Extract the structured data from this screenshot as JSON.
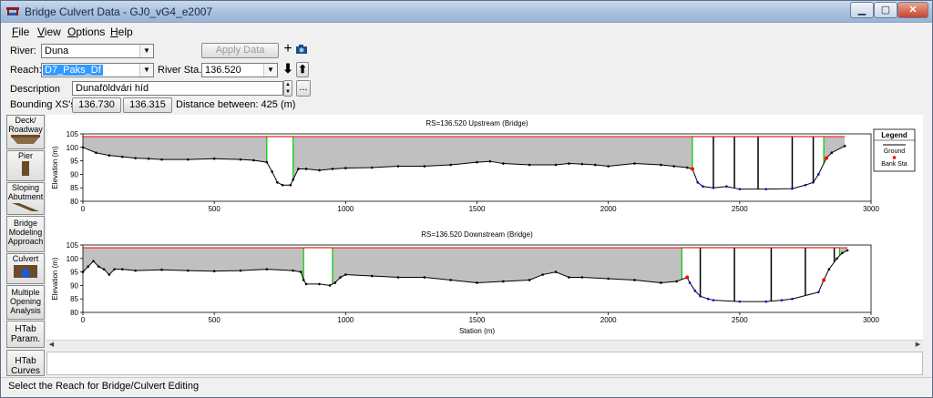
{
  "window": {
    "title": "Bridge Culvert Data - GJ0_vG4_e2007"
  },
  "menu": [
    "File",
    "View",
    "Options",
    "Help"
  ],
  "menu_underline": [
    "F",
    "V",
    "O",
    "H"
  ],
  "fields": {
    "river_label": "River:",
    "river_value": "Duna",
    "reach_label": "Reach:",
    "reach_value": "D7_Paks_Df",
    "river_sta_label": "River Sta.:",
    "river_sta_value": "136.520",
    "description_label": "Description",
    "description_value": "Dunaföldvári híd",
    "bounding_label": "Bounding XS's:",
    "bounding_up": "136.730",
    "bounding_down": "136.315",
    "distance_text": "Distance between: 425 (m)",
    "apply_label": "Apply Data",
    "more_label": "..."
  },
  "sidebar": [
    {
      "label": "Deck/ Roadway",
      "icon": "deck-icon"
    },
    {
      "label": "Pier",
      "icon": "pier-icon"
    },
    {
      "label": "Sloping Abutment",
      "icon": "abutment-icon"
    },
    {
      "label": "Bridge Modeling Approach",
      "icon": ""
    },
    {
      "label": "Culvert",
      "icon": "culvert-icon"
    },
    {
      "label": "Multiple Opening Analysis",
      "icon": ""
    },
    {
      "label": "HTab Param.",
      "icon": ""
    },
    {
      "label": "HTab Curves",
      "icon": ""
    }
  ],
  "legend": {
    "title": "Legend",
    "items": [
      "Ground",
      "Bank Sta"
    ]
  },
  "status": {
    "text": "Select the Reach for Bridge/Culvert Editing"
  },
  "colors": {
    "ground": "#000000",
    "fill": "#c0c0c0",
    "deck": "#ff0000",
    "opening": "#00cc00",
    "bank": "#ff0000",
    "ineffective": "#0000cc",
    "selected": "#3399ff"
  },
  "chart_data": [
    {
      "type": "line",
      "title": "RS=136.520 Upstream  (Bridge)",
      "xlabel": "",
      "ylabel": "Elevation (m)",
      "xlim": [
        0,
        3000
      ],
      "ylim": [
        80,
        105
      ],
      "xticks": [
        0,
        500,
        1000,
        1500,
        2000,
        2500,
        3000
      ],
      "yticks": [
        80,
        85,
        90,
        95,
        100,
        105
      ],
      "deck_elev": 104,
      "ground": [
        [
          0,
          100
        ],
        [
          50,
          98
        ],
        [
          100,
          97
        ],
        [
          150,
          96.5
        ],
        [
          200,
          96
        ],
        [
          250,
          95.8
        ],
        [
          300,
          95.5
        ],
        [
          400,
          95.5
        ],
        [
          500,
          95.8
        ],
        [
          600,
          95.5
        ],
        [
          650,
          95.2
        ],
        [
          700,
          94.5
        ],
        [
          720,
          91
        ],
        [
          740,
          87
        ],
        [
          760,
          86
        ],
        [
          790,
          86
        ],
        [
          800,
          88
        ],
        [
          820,
          92
        ],
        [
          850,
          92
        ],
        [
          900,
          91.5
        ],
        [
          950,
          92
        ],
        [
          1000,
          92.3
        ],
        [
          1100,
          92.5
        ],
        [
          1200,
          93
        ],
        [
          1300,
          93
        ],
        [
          1400,
          93.5
        ],
        [
          1500,
          94.5
        ],
        [
          1550,
          94.8
        ],
        [
          1600,
          94
        ],
        [
          1700,
          93.5
        ],
        [
          1800,
          93.5
        ],
        [
          1850,
          94
        ],
        [
          1900,
          93.8
        ],
        [
          1950,
          93.5
        ],
        [
          2000,
          93
        ],
        [
          2100,
          94
        ],
        [
          2200,
          93.5
        ],
        [
          2250,
          93
        ],
        [
          2300,
          92.5
        ],
        [
          2320,
          92
        ],
        [
          2340,
          87
        ],
        [
          2360,
          85.5
        ],
        [
          2400,
          85
        ],
        [
          2450,
          85.5
        ],
        [
          2500,
          84.5
        ],
        [
          2600,
          84.5
        ],
        [
          2700,
          84.7
        ],
        [
          2750,
          86
        ],
        [
          2780,
          87
        ],
        [
          2800,
          90
        ],
        [
          2830,
          96
        ],
        [
          2850,
          98
        ],
        [
          2900,
          100.5
        ]
      ],
      "openings": [
        [
          700,
          800
        ],
        [
          2320,
          2820
        ]
      ],
      "piers": [
        2400,
        2480,
        2570,
        2700,
        2780
      ],
      "bank": [
        2320,
        2830
      ]
    },
    {
      "type": "line",
      "title": "RS=136.520 Downstream  (Bridge)",
      "xlabel": "Station (m)",
      "ylabel": "Elevation (m)",
      "xlim": [
        0,
        3000
      ],
      "ylim": [
        80,
        105
      ],
      "xticks": [
        0,
        500,
        1000,
        1500,
        2000,
        2500,
        3000
      ],
      "yticks": [
        80,
        85,
        90,
        95,
        100,
        105
      ],
      "deck_elev": 104,
      "ground": [
        [
          0,
          95
        ],
        [
          20,
          97
        ],
        [
          40,
          99
        ],
        [
          60,
          97
        ],
        [
          80,
          96
        ],
        [
          100,
          94
        ],
        [
          120,
          96
        ],
        [
          150,
          96
        ],
        [
          200,
          95.5
        ],
        [
          300,
          95.8
        ],
        [
          400,
          95.5
        ],
        [
          500,
          95.3
        ],
        [
          600,
          95.5
        ],
        [
          700,
          96
        ],
        [
          800,
          95.5
        ],
        [
          830,
          95
        ],
        [
          840,
          92
        ],
        [
          850,
          90.5
        ],
        [
          900,
          90.5
        ],
        [
          940,
          90
        ],
        [
          960,
          91
        ],
        [
          980,
          93
        ],
        [
          1000,
          94
        ],
        [
          1100,
          93.5
        ],
        [
          1200,
          93
        ],
        [
          1300,
          93
        ],
        [
          1400,
          92
        ],
        [
          1500,
          91
        ],
        [
          1600,
          91.5
        ],
        [
          1700,
          92
        ],
        [
          1750,
          94
        ],
        [
          1800,
          95
        ],
        [
          1850,
          93
        ],
        [
          1900,
          93
        ],
        [
          2000,
          92.5
        ],
        [
          2100,
          92
        ],
        [
          2200,
          91
        ],
        [
          2260,
          91.5
        ],
        [
          2300,
          93
        ],
        [
          2310,
          91
        ],
        [
          2330,
          88
        ],
        [
          2350,
          86
        ],
        [
          2380,
          85
        ],
        [
          2400,
          84.5
        ],
        [
          2500,
          84
        ],
        [
          2600,
          84
        ],
        [
          2660,
          84.5
        ],
        [
          2700,
          85
        ],
        [
          2800,
          87.5
        ],
        [
          2820,
          92
        ],
        [
          2840,
          96
        ],
        [
          2870,
          100
        ],
        [
          2890,
          102
        ],
        [
          2910,
          103
        ]
      ],
      "openings": [
        [
          840,
          950
        ],
        [
          2280,
          2880
        ]
      ],
      "piers": [
        2350,
        2480,
        2620,
        2750,
        2860
      ],
      "bank": [
        2300,
        2820
      ]
    }
  ]
}
